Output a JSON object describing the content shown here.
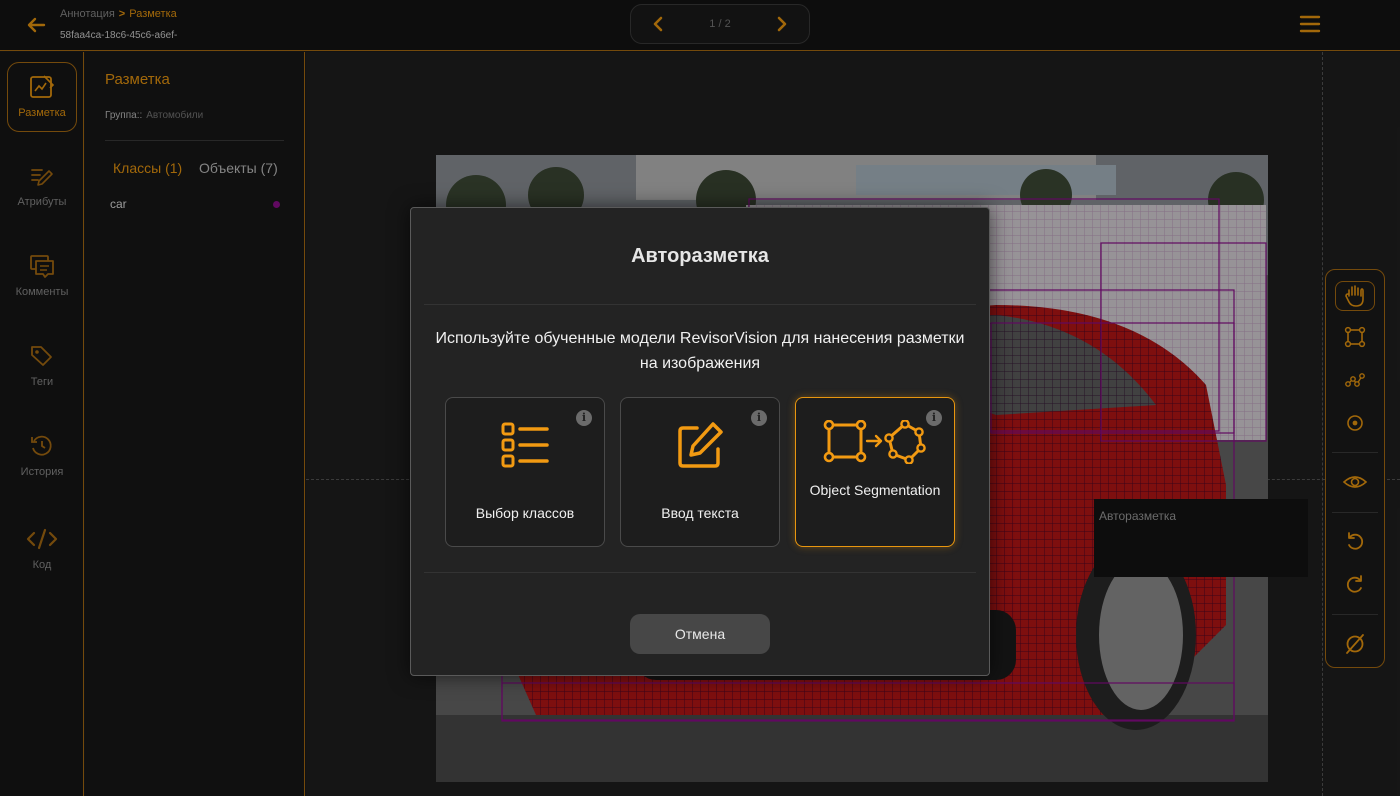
{
  "breadcrumb": {
    "parent": "Аннотация",
    "separator": ">",
    "current": "Разметка"
  },
  "file_id": "58faa4ca-18c6-45c6-a6ef-",
  "pager": {
    "label": "1 / 2"
  },
  "rail": {
    "items": [
      {
        "label": "Разметка",
        "icon": "markup-icon"
      },
      {
        "label": "Атрибуты",
        "icon": "attributes-icon"
      },
      {
        "label": "Комменты",
        "icon": "comments-icon"
      },
      {
        "label": "Теги",
        "icon": "tags-icon"
      },
      {
        "label": "История",
        "icon": "history-icon"
      },
      {
        "label": "Код",
        "icon": "code-icon"
      }
    ]
  },
  "panel": {
    "title": "Разметка",
    "group_label": "Группа::",
    "group_value": "Автомобили",
    "tabs": {
      "classes": "Классы (1)",
      "objects": "Объекты (7)"
    },
    "classes": [
      {
        "name": "car",
        "color": "#8b0d8b"
      }
    ]
  },
  "tooltip": {
    "text": "Авторазметка"
  },
  "modal": {
    "title": "Авторазметка",
    "description": "Используйте обученные модели RevisorVision для нанесения разметки на изображения",
    "options": [
      {
        "label": "Выбор классов",
        "icon": "list-icon"
      },
      {
        "label": "Ввод текста",
        "icon": "edit-icon"
      },
      {
        "label": "Object Segmentation",
        "icon": "polygon-transform-icon"
      }
    ],
    "info_glyph": "i",
    "cancel_label": "Отмена"
  },
  "colors": {
    "accent": "#e8960f",
    "class_color": "#8b0d8b",
    "background": "#1b1b1b"
  }
}
